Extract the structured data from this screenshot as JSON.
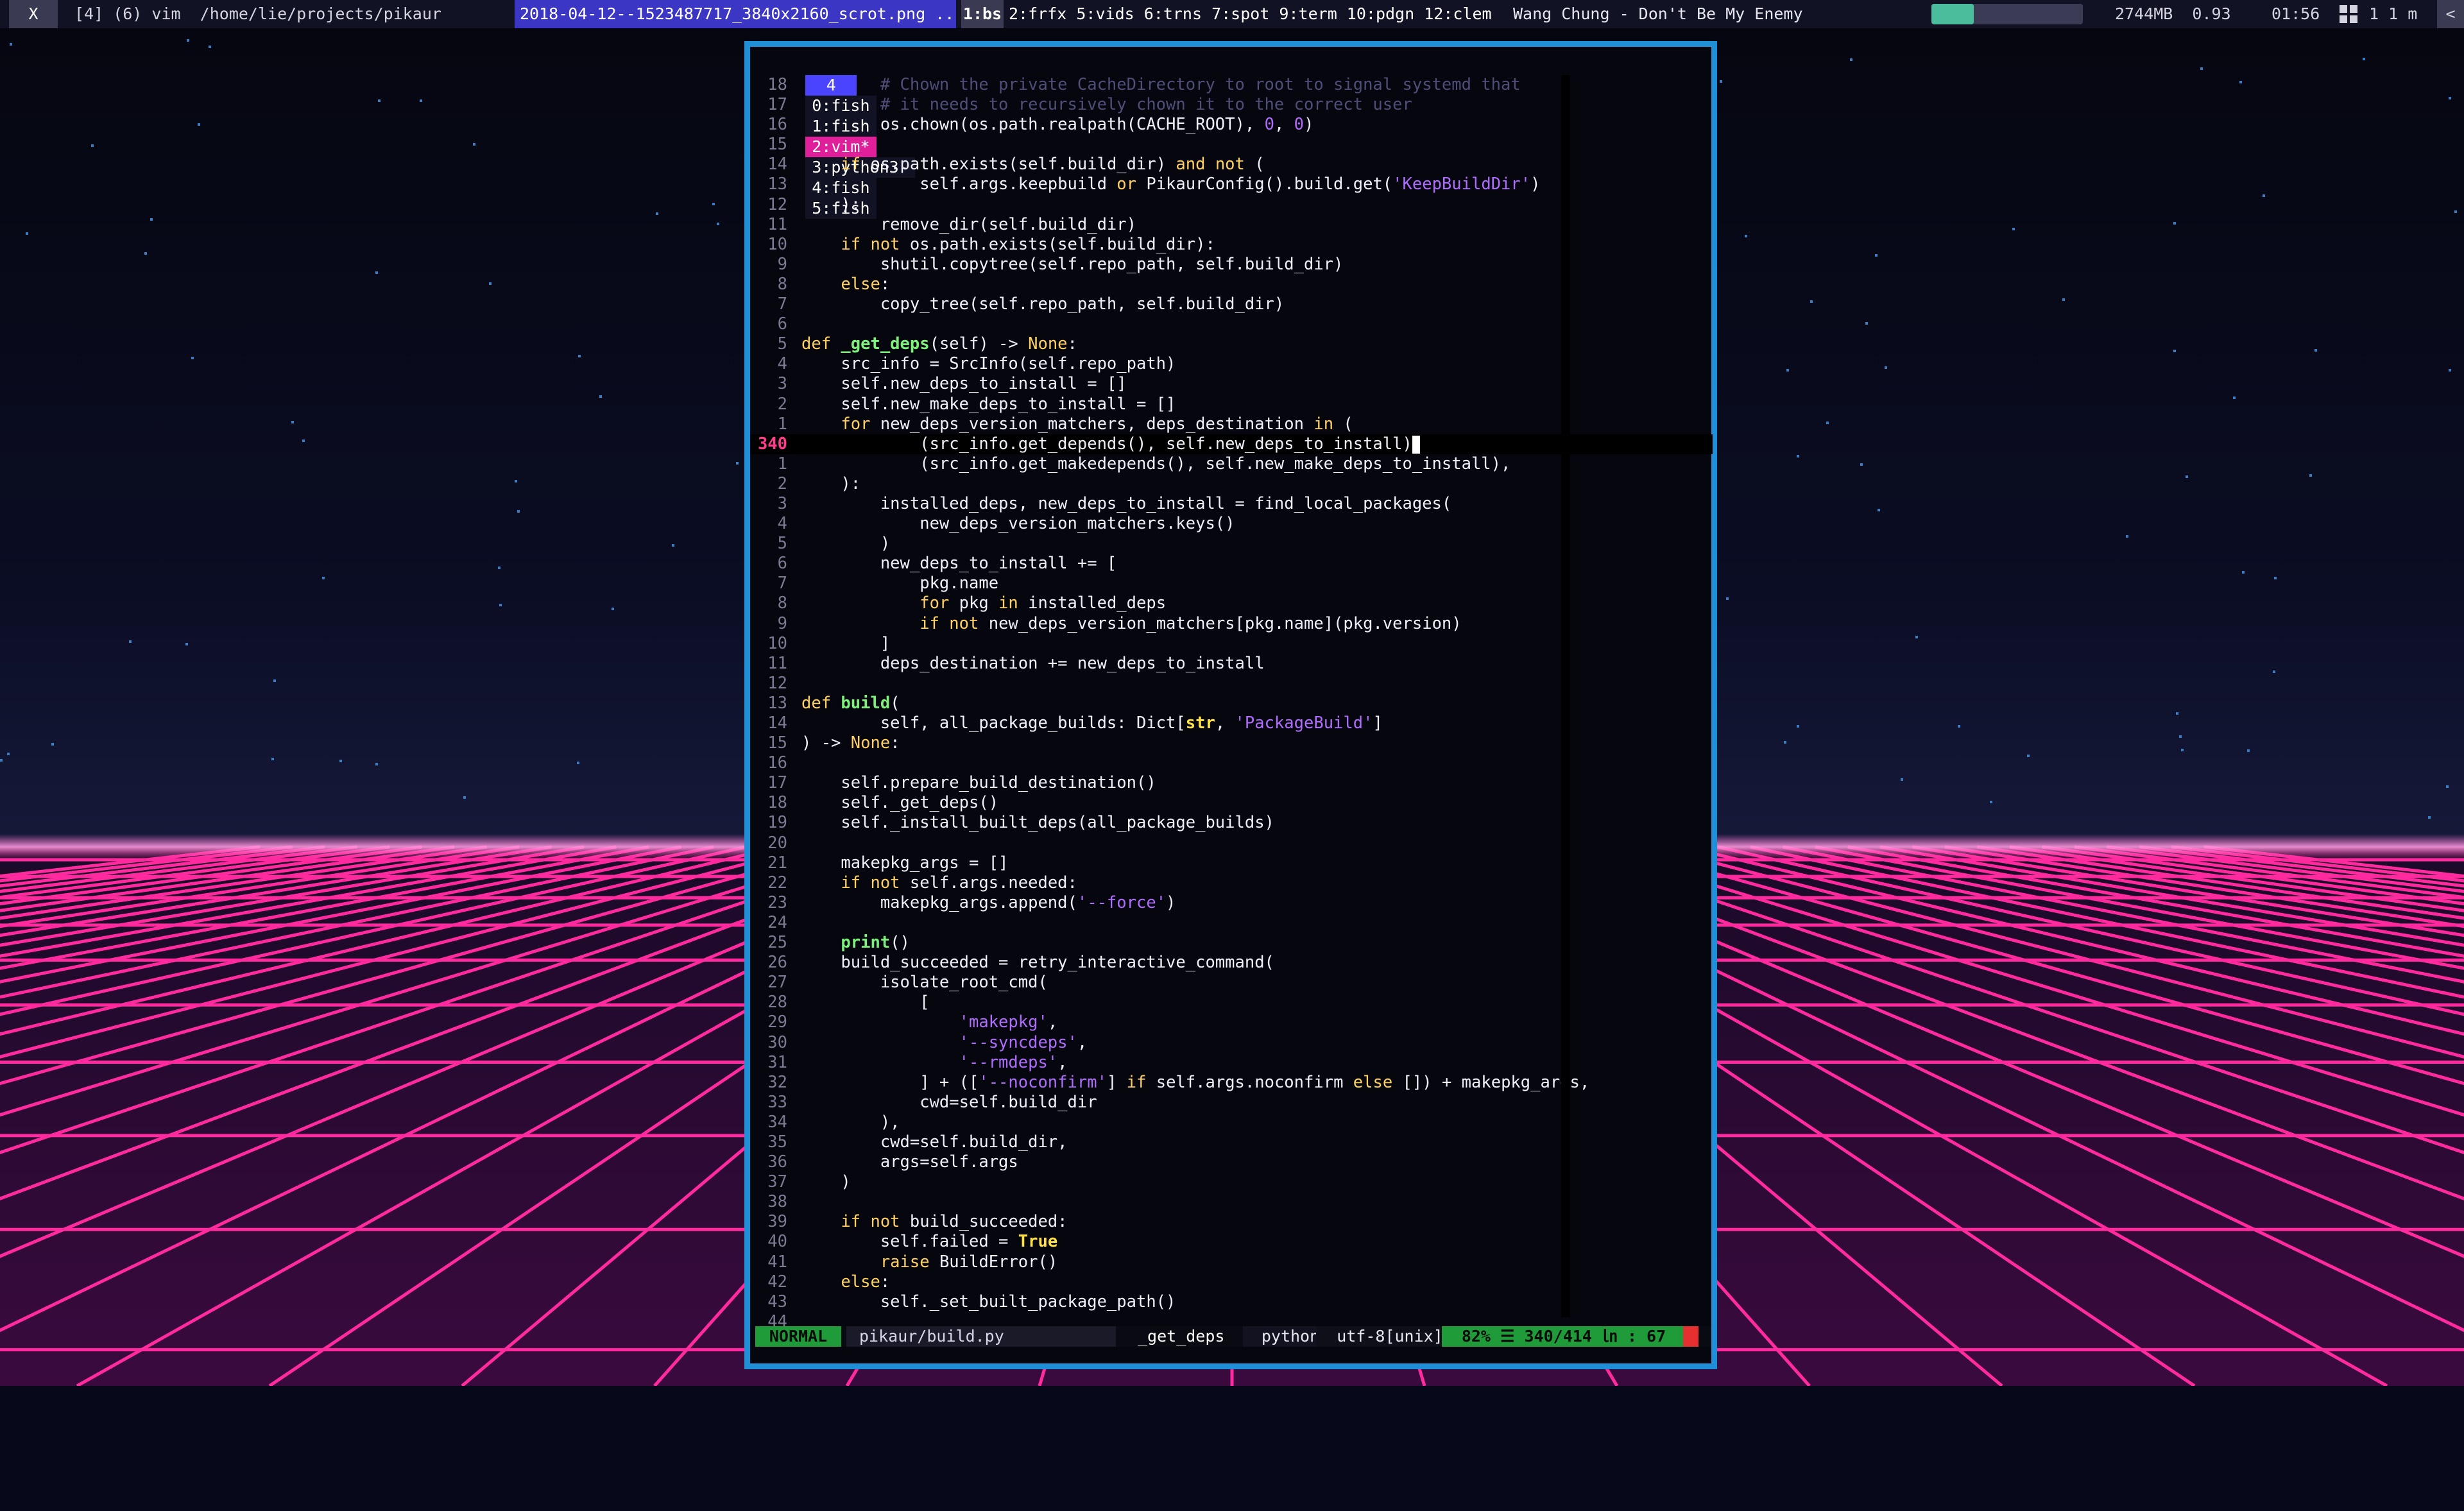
{
  "topbar": {
    "close": "X",
    "window_title": "[4] (6) vim  /home/lie/projects/pikaur",
    "file_tab": "2018-04-12--1523487717_3840x2160_scrot.png ...",
    "active_workspace": "1:bs",
    "workspaces": "2:frfx 5:vids 6:trns 7:spot 9:term 10:pdgn 12:clem",
    "song": "Wang Chung - Don't Be My Enemy",
    "volume": 0.28,
    "memory": "2744MB  0.93",
    "clock": "01:56",
    "tags": "1 1 m",
    "arrow": "<",
    "colors": {
      "bar": "#121225",
      "file_tab": "#3c36c4",
      "volume_fill": "#4bbd9d"
    }
  },
  "tmux": {
    "session": "4",
    "windows": [
      "0:fish",
      "1:fish",
      "2:vim*",
      "3:python3-",
      "4:fish",
      "5:fish"
    ],
    "active_index": 2
  },
  "editor": {
    "cursor_line_index": 21,
    "lines": [
      {
        "n": "18",
        "t": [
          [
            "        # Chown the private CacheDirectory to root to signal systemd that",
            "c"
          ]
        ]
      },
      {
        "n": "17",
        "t": [
          [
            "        # it needs to recursively chown it to the correct user",
            "c"
          ]
        ]
      },
      {
        "n": "16",
        "t": [
          [
            "        os.chown(os.path.realpath(CACHE_ROOT), ",
            ""
          ],
          [
            "0",
            "n"
          ],
          [
            ", ",
            ""
          ],
          [
            "0",
            "n"
          ],
          [
            ")",
            ""
          ]
        ]
      },
      {
        "n": "15",
        "t": [
          [
            "",
            ""
          ]
        ]
      },
      {
        "n": "14",
        "t": [
          [
            "    ",
            ""
          ],
          [
            "if",
            "k"
          ],
          [
            " os.path.exists(self.build_dir) ",
            ""
          ],
          [
            "and not",
            "k"
          ],
          [
            " (",
            ""
          ]
        ]
      },
      {
        "n": "13",
        "t": [
          [
            "            self.args.keepbuild ",
            ""
          ],
          [
            "or",
            "k"
          ],
          [
            " PikaurConfig().build.get(",
            ""
          ],
          [
            "'KeepBuildDir'",
            "s"
          ],
          [
            ")",
            ""
          ]
        ]
      },
      {
        "n": "12",
        "t": [
          [
            "    ):",
            ""
          ]
        ]
      },
      {
        "n": "11",
        "t": [
          [
            "        remove_dir(self.build_dir)",
            ""
          ]
        ]
      },
      {
        "n": "10",
        "t": [
          [
            "    ",
            ""
          ],
          [
            "if not",
            "k"
          ],
          [
            " os.path.exists(self.build_dir):",
            ""
          ]
        ]
      },
      {
        "n": "9",
        "t": [
          [
            "        shutil.copytree(self.repo_path, self.build_dir)",
            ""
          ]
        ]
      },
      {
        "n": "8",
        "t": [
          [
            "    ",
            ""
          ],
          [
            "else",
            "k"
          ],
          [
            ":",
            ""
          ]
        ]
      },
      {
        "n": "7",
        "t": [
          [
            "        copy_tree(self.repo_path, self.build_dir)",
            ""
          ]
        ]
      },
      {
        "n": "6",
        "t": [
          [
            "",
            ""
          ]
        ]
      },
      {
        "n": "5",
        "t": [
          [
            "def",
            "k"
          ],
          [
            " ",
            ""
          ],
          [
            "_get_deps",
            "f"
          ],
          [
            "(self) -> ",
            ""
          ],
          [
            "None",
            "k"
          ],
          [
            ":",
            ""
          ]
        ]
      },
      {
        "n": "4",
        "t": [
          [
            "    src_info = SrcInfo(self.repo_path)",
            ""
          ]
        ]
      },
      {
        "n": "3",
        "t": [
          [
            "    self.new_deps_to_install = []",
            ""
          ]
        ]
      },
      {
        "n": "2",
        "t": [
          [
            "    self.new_make_deps_to_install = []",
            ""
          ]
        ]
      },
      {
        "n": "1",
        "t": [
          [
            "    ",
            ""
          ],
          [
            "for",
            "k"
          ],
          [
            " new_deps_version_matchers, deps_destination ",
            ""
          ],
          [
            "in",
            "k"
          ],
          [
            " (",
            ""
          ]
        ]
      },
      {
        "n": "340",
        "t": [
          [
            "            (src_info.get_depends(), self.new_deps_to_install)",
            ""
          ]
        ],
        "cursor": true
      },
      {
        "n": "1",
        "t": [
          [
            "            (src_info.get_makedepends(), self.new_make_deps_to_install),",
            ""
          ]
        ]
      },
      {
        "n": "2",
        "t": [
          [
            "    ):",
            ""
          ]
        ]
      },
      {
        "n": "3",
        "t": [
          [
            "        installed_deps, new_deps_to_install = find_local_packages(",
            ""
          ]
        ]
      },
      {
        "n": "4",
        "t": [
          [
            "            new_deps_version_matchers.keys()",
            ""
          ]
        ]
      },
      {
        "n": "5",
        "t": [
          [
            "        )",
            ""
          ]
        ]
      },
      {
        "n": "6",
        "t": [
          [
            "        new_deps_to_install += [",
            ""
          ]
        ]
      },
      {
        "n": "7",
        "t": [
          [
            "            pkg.name",
            ""
          ]
        ]
      },
      {
        "n": "8",
        "t": [
          [
            "            ",
            ""
          ],
          [
            "for",
            "k"
          ],
          [
            " pkg ",
            ""
          ],
          [
            "in",
            "k"
          ],
          [
            " installed_deps",
            ""
          ]
        ]
      },
      {
        "n": "9",
        "t": [
          [
            "            ",
            ""
          ],
          [
            "if not",
            "k"
          ],
          [
            " new_deps_version_matchers[pkg.name](pkg.version)",
            ""
          ]
        ]
      },
      {
        "n": "10",
        "t": [
          [
            "        ]",
            ""
          ]
        ]
      },
      {
        "n": "11",
        "t": [
          [
            "        deps_destination += new_deps_to_install",
            ""
          ]
        ]
      },
      {
        "n": "12",
        "t": [
          [
            "",
            ""
          ]
        ]
      },
      {
        "n": "13",
        "t": [
          [
            "def",
            "k"
          ],
          [
            " ",
            ""
          ],
          [
            "build",
            "f"
          ],
          [
            "(",
            ""
          ]
        ]
      },
      {
        "n": "14",
        "t": [
          [
            "        self, all_package_builds: Dict[",
            ""
          ],
          [
            "str",
            "b"
          ],
          [
            ", ",
            ""
          ],
          [
            "'PackageBuild'",
            "s"
          ],
          [
            "]",
            ""
          ]
        ]
      },
      {
        "n": "15",
        "t": [
          [
            ") -> ",
            ""
          ],
          [
            "None",
            "k"
          ],
          [
            ":",
            ""
          ]
        ]
      },
      {
        "n": "16",
        "t": [
          [
            "",
            ""
          ]
        ]
      },
      {
        "n": "17",
        "t": [
          [
            "    self.prepare_build_destination()",
            ""
          ]
        ]
      },
      {
        "n": "18",
        "t": [
          [
            "    self._get_deps()",
            ""
          ]
        ]
      },
      {
        "n": "19",
        "t": [
          [
            "    self._install_built_deps(all_package_builds)",
            ""
          ]
        ]
      },
      {
        "n": "20",
        "t": [
          [
            "",
            ""
          ]
        ]
      },
      {
        "n": "21",
        "t": [
          [
            "    makepkg_args = []",
            ""
          ]
        ]
      },
      {
        "n": "22",
        "t": [
          [
            "    ",
            ""
          ],
          [
            "if not",
            "k"
          ],
          [
            " self.args.needed:",
            ""
          ]
        ]
      },
      {
        "n": "23",
        "t": [
          [
            "        makepkg_args.append(",
            ""
          ],
          [
            "'--force'",
            "s"
          ],
          [
            ")",
            ""
          ]
        ]
      },
      {
        "n": "24",
        "t": [
          [
            "",
            ""
          ]
        ]
      },
      {
        "n": "25",
        "t": [
          [
            "    ",
            ""
          ],
          [
            "print",
            "f"
          ],
          [
            "()",
            ""
          ]
        ]
      },
      {
        "n": "26",
        "t": [
          [
            "    build_succeeded = retry_interactive_command(",
            ""
          ]
        ]
      },
      {
        "n": "27",
        "t": [
          [
            "        isolate_root_cmd(",
            ""
          ]
        ]
      },
      {
        "n": "28",
        "t": [
          [
            "            [",
            ""
          ]
        ]
      },
      {
        "n": "29",
        "t": [
          [
            "                ",
            ""
          ],
          [
            "'makepkg'",
            "s"
          ],
          [
            ",",
            ""
          ]
        ]
      },
      {
        "n": "30",
        "t": [
          [
            "                ",
            ""
          ],
          [
            "'--syncdeps'",
            "s"
          ],
          [
            ",",
            ""
          ]
        ]
      },
      {
        "n": "31",
        "t": [
          [
            "                ",
            ""
          ],
          [
            "'--rmdeps'",
            "s"
          ],
          [
            ",",
            ""
          ]
        ]
      },
      {
        "n": "32",
        "t": [
          [
            "            ] + ([",
            ""
          ],
          [
            "'--noconfirm'",
            "s"
          ],
          [
            "] ",
            ""
          ],
          [
            "if",
            "k"
          ],
          [
            " self.args.noconfirm ",
            ""
          ],
          [
            "else",
            "k"
          ],
          [
            " []) + makepkg_args,",
            ""
          ]
        ]
      },
      {
        "n": "33",
        "t": [
          [
            "            cwd=self.build_dir",
            ""
          ]
        ]
      },
      {
        "n": "34",
        "t": [
          [
            "        ),",
            ""
          ]
        ]
      },
      {
        "n": "35",
        "t": [
          [
            "        cwd=self.build_dir,",
            ""
          ]
        ]
      },
      {
        "n": "36",
        "t": [
          [
            "        args=self.args",
            ""
          ]
        ]
      },
      {
        "n": "37",
        "t": [
          [
            "    )",
            ""
          ]
        ]
      },
      {
        "n": "38",
        "t": [
          [
            "",
            ""
          ]
        ]
      },
      {
        "n": "39",
        "t": [
          [
            "    ",
            ""
          ],
          [
            "if not",
            "k"
          ],
          [
            " build_succeeded:",
            ""
          ]
        ]
      },
      {
        "n": "40",
        "t": [
          [
            "        self.failed = ",
            ""
          ],
          [
            "True",
            "b"
          ]
        ]
      },
      {
        "n": "41",
        "t": [
          [
            "        ",
            ""
          ],
          [
            "raise",
            "k"
          ],
          [
            " BuildError()",
            ""
          ]
        ]
      },
      {
        "n": "42",
        "t": [
          [
            "    ",
            ""
          ],
          [
            "else",
            "k"
          ],
          [
            ":",
            ""
          ]
        ]
      },
      {
        "n": "43",
        "t": [
          [
            "        self._set_built_package_path()",
            ""
          ]
        ]
      },
      {
        "n": "44",
        "t": [
          [
            "",
            ""
          ]
        ]
      }
    ]
  },
  "status": {
    "mode": "NORMAL",
    "file": "pikaur/build.py",
    "function": "_get_deps",
    "filetype": "python",
    "encoding": "utf-8[unix]",
    "position": "82% ☰ 340/414 ㏑ : 67"
  }
}
